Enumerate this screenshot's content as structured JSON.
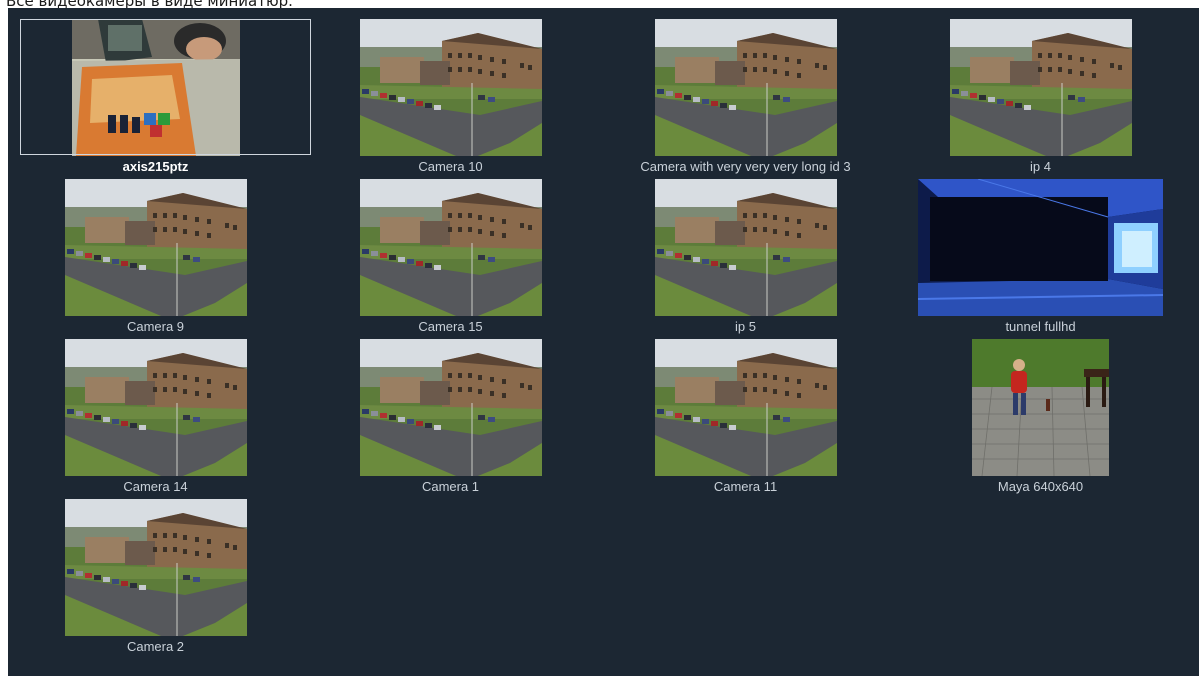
{
  "header": {
    "title": "Все видеокамеры в виде миниатюр."
  },
  "cameras": [
    {
      "name": "axis215ptz",
      "thumb": "person",
      "selected": true
    },
    {
      "name": "Camera 10",
      "thumb": "building"
    },
    {
      "name": "Camera with very very very long id 3",
      "thumb": "building"
    },
    {
      "name": "ip 4",
      "thumb": "building"
    },
    {
      "name": "Camera 9",
      "thumb": "building"
    },
    {
      "name": "Camera 15",
      "thumb": "building"
    },
    {
      "name": "ip 5",
      "thumb": "building"
    },
    {
      "name": "tunnel fullhd",
      "thumb": "tunnel"
    },
    {
      "name": "Camera 14",
      "thumb": "building"
    },
    {
      "name": "Camera 1",
      "thumb": "building"
    },
    {
      "name": "Camera 11",
      "thumb": "building"
    },
    {
      "name": "Maya 640x640",
      "thumb": "child"
    },
    {
      "name": "Camera 2",
      "thumb": "building"
    }
  ],
  "colors": {
    "panel_bg": "#1c2733",
    "label_text": "#c9d1d9",
    "selected_label": "#ffffff",
    "selection_border": "#cfd6de"
  }
}
